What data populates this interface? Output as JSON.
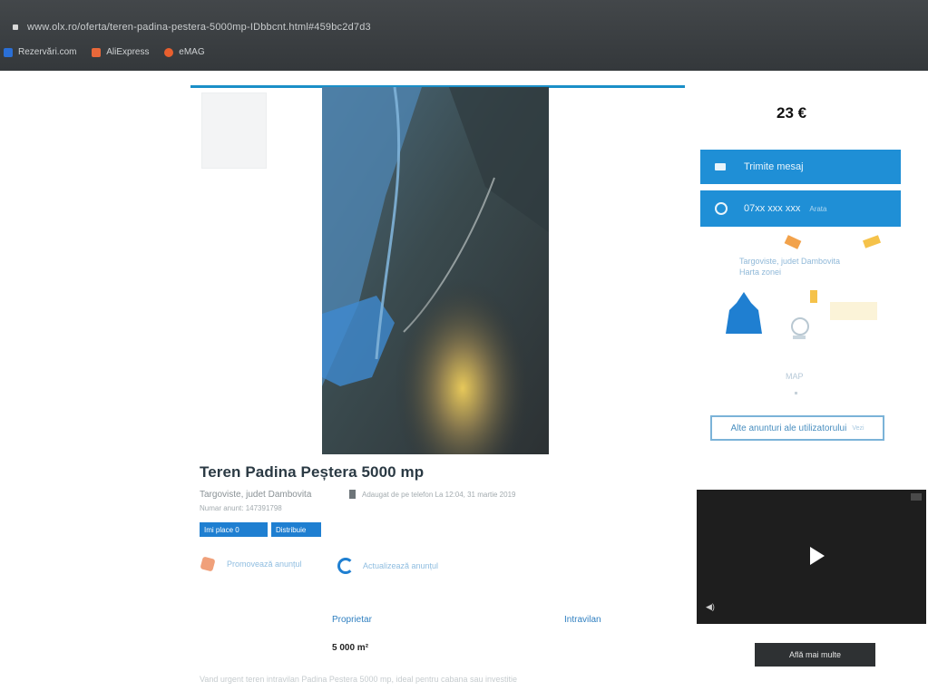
{
  "browser": {
    "url": "www.olx.ro/oferta/teren-padina-pestera-5000mp-IDbbcnt.html#459bc2d7d3",
    "bookmarks": [
      {
        "label": "Rezervări.com",
        "color": "#2a6fd6",
        "icon": "bookmark-icon"
      },
      {
        "label": "AliExpress",
        "color": "#e8683a",
        "icon": "aliexpress-icon"
      },
      {
        "label": "eMAG",
        "color": "#e85f2e",
        "icon": "emag-icon"
      }
    ]
  },
  "listing": {
    "title": "Teren Padina Peștera 5000 mp",
    "location": "Targoviste, judet Dambovita",
    "added": "Adaugat de pe telefon La 12:04, 31 martie 2019",
    "ad_number": "Numar anunt: 147391798",
    "like_label": "Imi place 0",
    "share_label": "Distribuie",
    "action_watch": "Promovează anunțul",
    "action_refresh": "Actualizează anunțul",
    "specs": [
      {
        "label": "Proprietar",
        "value": "5 000 m²"
      },
      {
        "label": "Intravilan",
        "value": ""
      }
    ],
    "description": "Vand urgent teren intravilan Padina Pestera 5000 mp, ideal pentru cabana sau investitie"
  },
  "sidebar": {
    "price": "23 €",
    "message_button": "Trimite mesaj",
    "call_button": "07xx xxx xxx",
    "call_sub": "Arata",
    "seller_location": "Targoviste, judet Dambovita Harta zonei",
    "faint_text": "MAP",
    "other_ads_button": "Alte anunturi ale utilizatorului",
    "other_ads_sub": "Vezi"
  },
  "video": {
    "volume_icon": "volume-icon",
    "more_button": "Află mai multe"
  },
  "colors": {
    "accent": "#1f8fd6",
    "header_bg": "#3b3f42",
    "video_bg": "#1e1e1e"
  }
}
